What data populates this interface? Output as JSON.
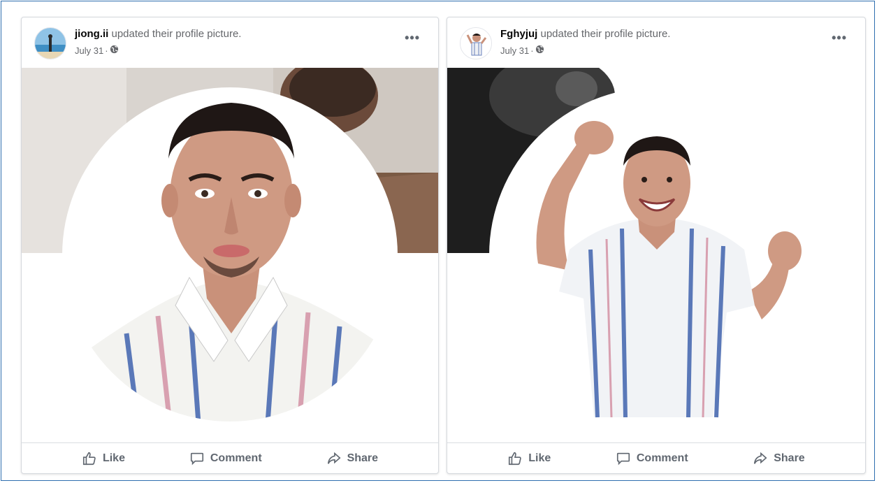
{
  "posts": [
    {
      "username": "jiong.ii",
      "action_text": "updated their profile picture.",
      "date": "July 31",
      "separator": "·",
      "privacy_icon": "globe-icon",
      "more_icon": "more-options-icon",
      "more_label": "•••",
      "actions": {
        "like": "Like",
        "comment": "Comment",
        "share": "Share"
      }
    },
    {
      "username": "Fghyjuj",
      "action_text": "updated their profile picture.",
      "date": "July 31",
      "separator": "·",
      "privacy_icon": "globe-icon",
      "more_icon": "more-options-icon",
      "more_label": "•••",
      "actions": {
        "like": "Like",
        "comment": "Comment",
        "share": "Share"
      }
    }
  ],
  "colors": {
    "frame_border": "#2f6fb0",
    "text_primary": "#050505",
    "text_secondary": "#65676b",
    "action_gray": "#606770"
  }
}
